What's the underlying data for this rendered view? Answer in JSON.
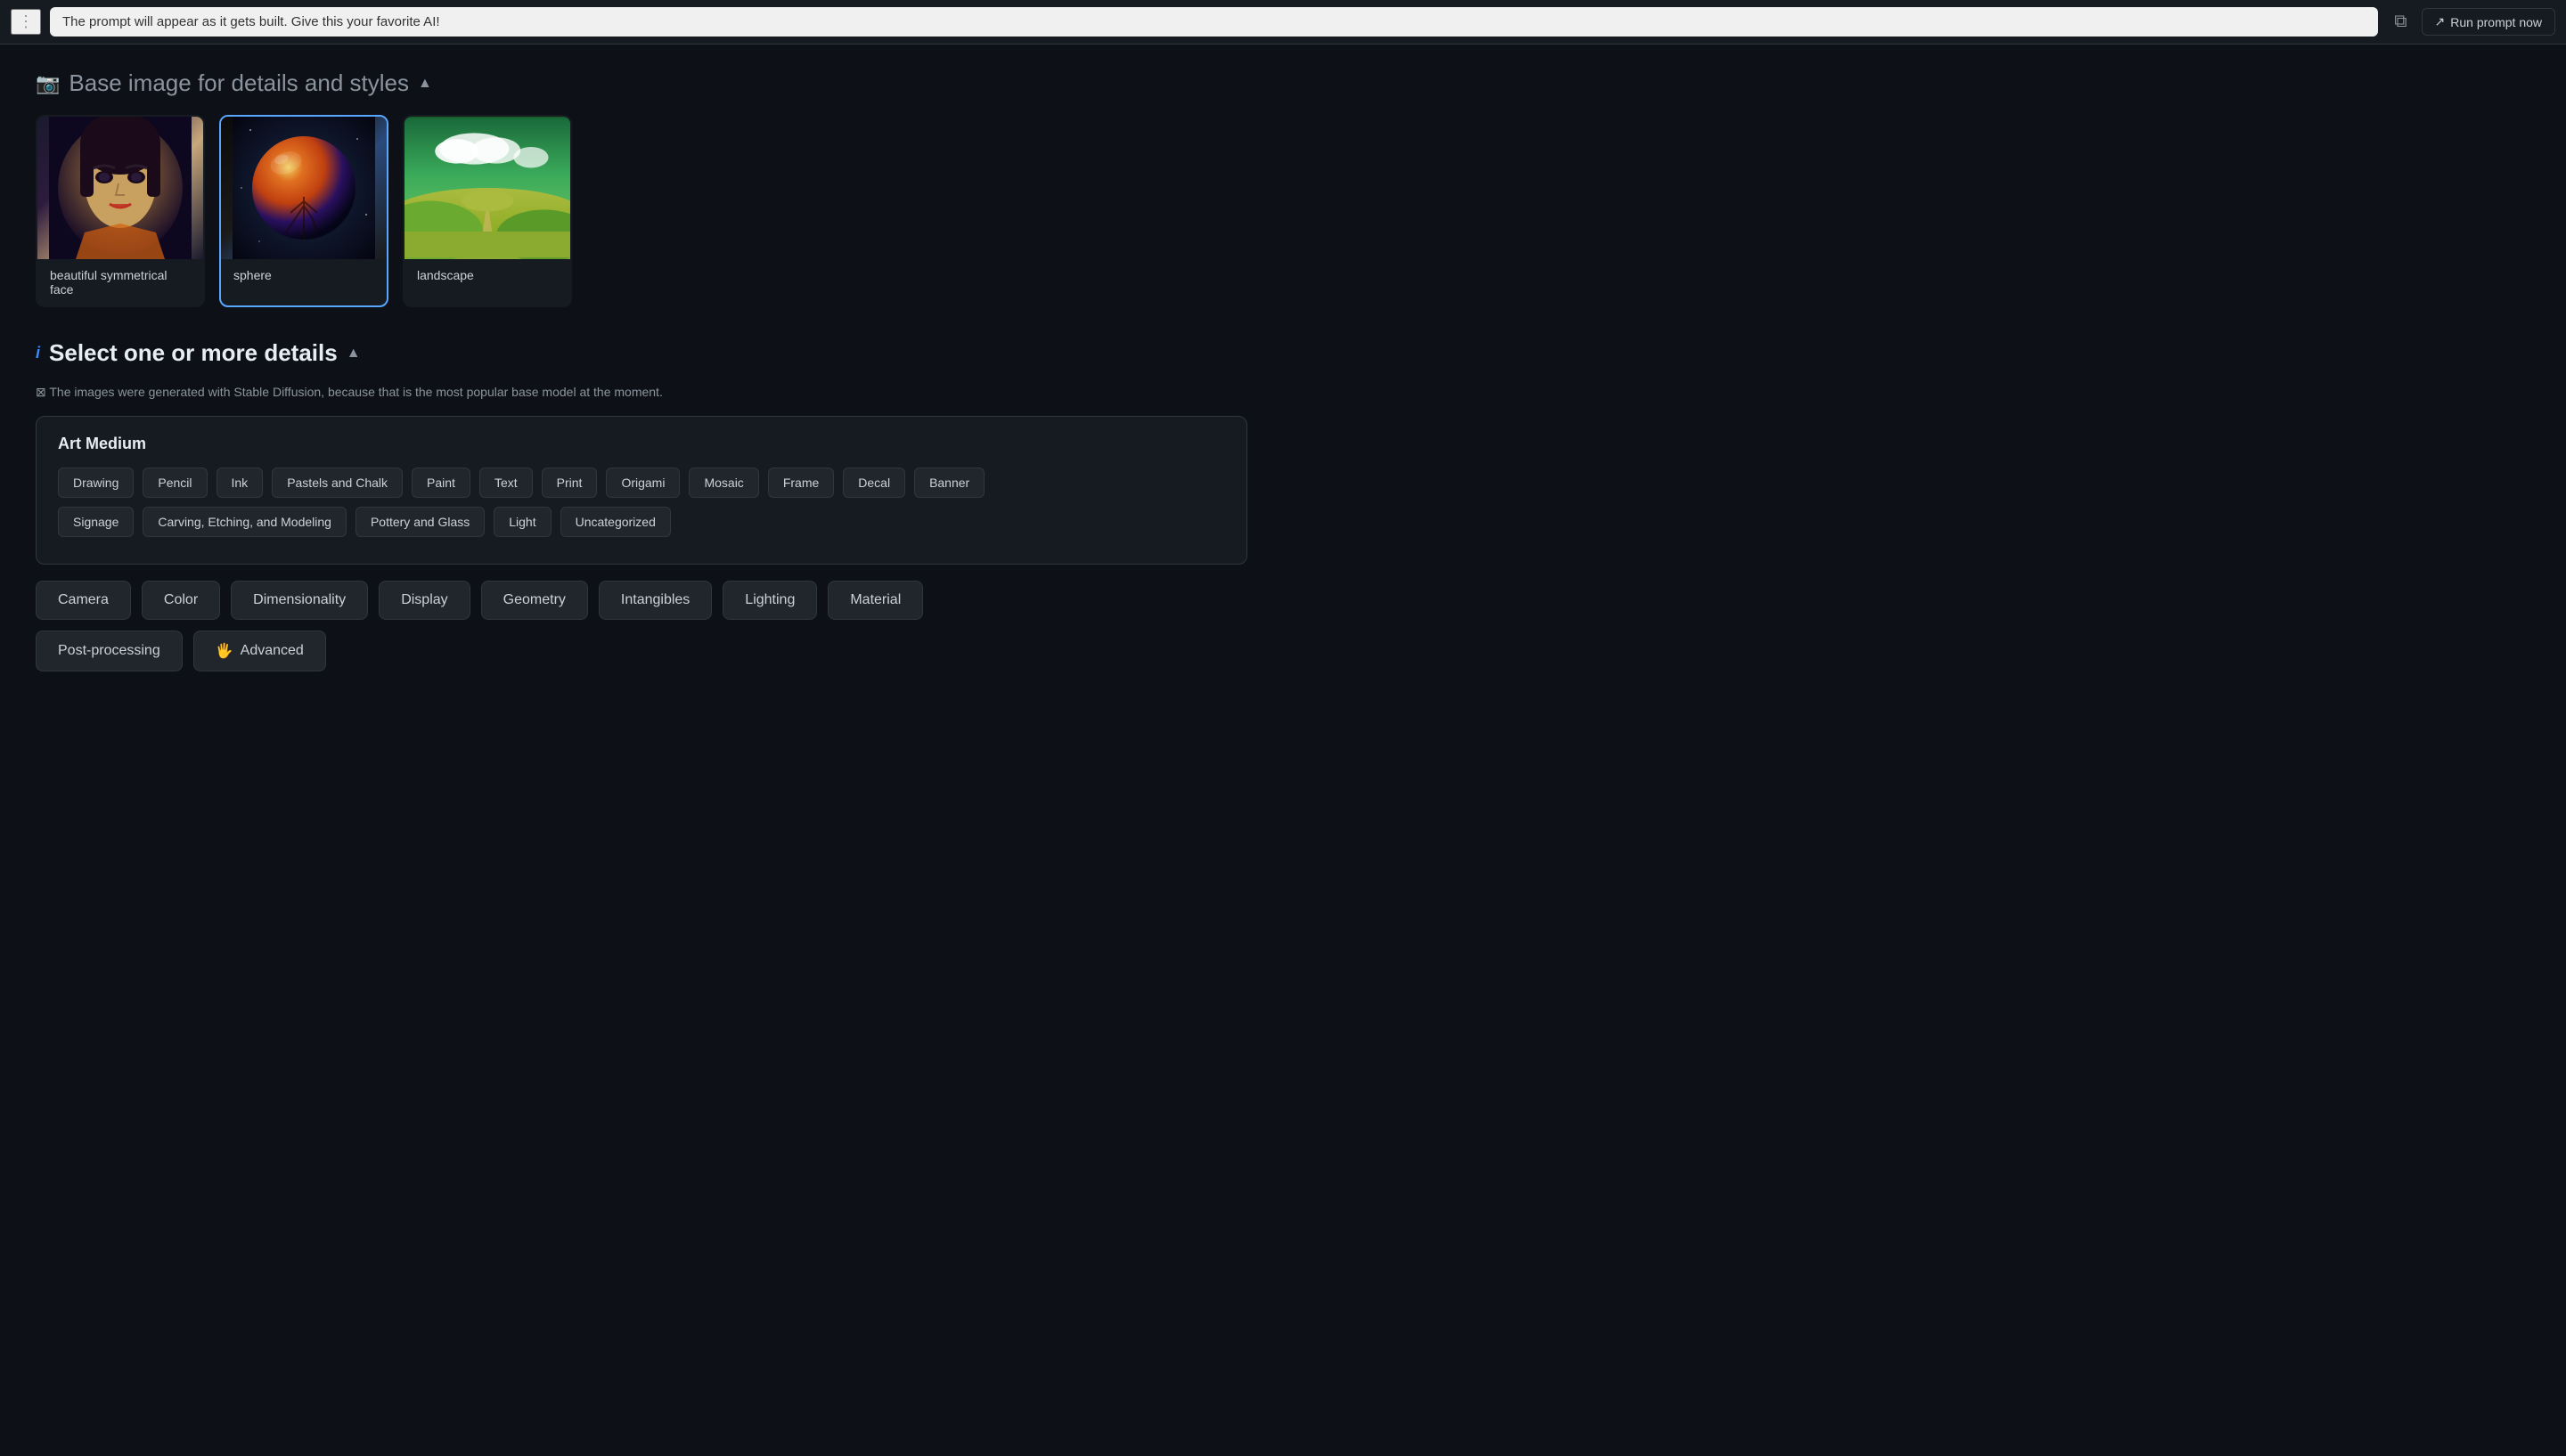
{
  "topbar": {
    "prompt_placeholder": "The prompt will appear as it gets built. Give this your favorite AI!",
    "prompt_value": "The prompt will appear as it gets built. Give this your favorite AI!",
    "dots_icon": "⋮",
    "copy_icon": "⧉",
    "run_label": "Run prompt now",
    "run_icon": "↗"
  },
  "base_image_section": {
    "icon": "📷",
    "title": "Base image",
    "subtitle": "for details and styles",
    "collapse_icon": "▲",
    "cards": [
      {
        "id": "face",
        "label": "beautiful symmetrical face",
        "type": "face",
        "selected": false
      },
      {
        "id": "sphere",
        "label": "sphere",
        "type": "sphere",
        "selected": true
      },
      {
        "id": "landscape",
        "label": "landscape",
        "type": "landscape",
        "selected": false
      }
    ]
  },
  "details_section": {
    "info_icon": "i",
    "title": "Select one or more details",
    "collapse_icon": "▲",
    "note": "⊠ The images were generated with Stable Diffusion, because that is the most popular base model at the moment.",
    "art_medium": {
      "label": "Art Medium",
      "tags_row1": [
        {
          "id": "drawing",
          "label": "Drawing"
        },
        {
          "id": "pencil",
          "label": "Pencil"
        },
        {
          "id": "ink",
          "label": "Ink"
        },
        {
          "id": "pastels_chalk",
          "label": "Pastels and Chalk"
        },
        {
          "id": "paint",
          "label": "Paint"
        },
        {
          "id": "text",
          "label": "Text"
        },
        {
          "id": "print",
          "label": "Print"
        },
        {
          "id": "origami",
          "label": "Origami"
        },
        {
          "id": "mosaic",
          "label": "Mosaic"
        },
        {
          "id": "frame",
          "label": "Frame"
        },
        {
          "id": "decal",
          "label": "Decal"
        },
        {
          "id": "banner",
          "label": "Banner"
        }
      ],
      "tags_row2": [
        {
          "id": "signage",
          "label": "Signage"
        },
        {
          "id": "carving",
          "label": "Carving, Etching, and Modeling"
        },
        {
          "id": "pottery",
          "label": "Pottery and Glass"
        },
        {
          "id": "light",
          "label": "Light"
        },
        {
          "id": "uncategorized",
          "label": "Uncategorized"
        }
      ]
    },
    "categories": [
      {
        "id": "camera",
        "label": "Camera"
      },
      {
        "id": "color",
        "label": "Color"
      },
      {
        "id": "dimensionality",
        "label": "Dimensionality"
      },
      {
        "id": "display",
        "label": "Display"
      },
      {
        "id": "geometry",
        "label": "Geometry"
      },
      {
        "id": "intangibles",
        "label": "Intangibles"
      },
      {
        "id": "lighting",
        "label": "Lighting"
      },
      {
        "id": "material",
        "label": "Material"
      }
    ],
    "advanced_label": "Advanced",
    "advanced_icon": "🖐",
    "postprocessing_label": "Post-processing"
  }
}
